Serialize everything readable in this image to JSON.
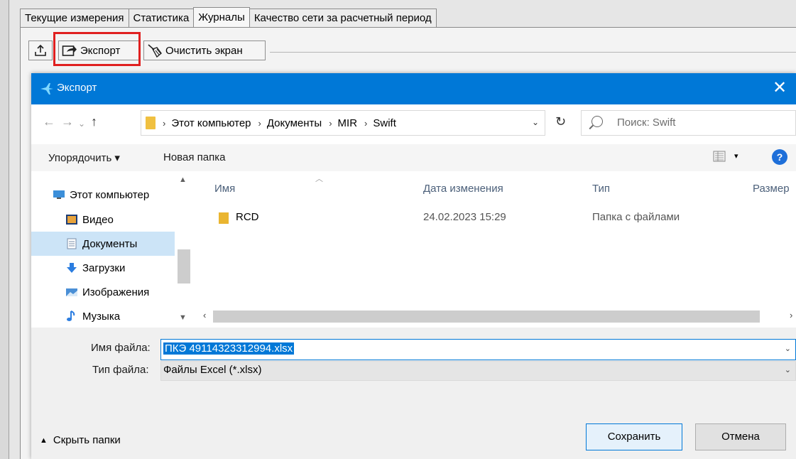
{
  "app": {
    "tabs": [
      "Текущие измерения",
      "Статистика",
      "Журналы",
      "Качество сети за расчетный период"
    ],
    "active_tab_index": 2,
    "toolbar": {
      "export_label": "Экспорт",
      "clear_label": "Очистить экран"
    }
  },
  "dialog": {
    "title": "Экспорт",
    "close_glyph": "✕",
    "nav": {
      "back": "←",
      "forward": "→",
      "recent": "⌄",
      "up": "↑"
    },
    "breadcrumb": [
      "Этот компьютер",
      "Документы",
      "MIR",
      "Swift"
    ],
    "breadcrumb_sep": "›",
    "address_dropdown": "⌄",
    "refresh": "↻",
    "search_placeholder": "Поиск: Swift",
    "commands": {
      "organize": "Упорядочить ▾",
      "new_folder": "Новая папка",
      "view_drop": "▾",
      "help": "?"
    },
    "nav_pane": [
      {
        "label": "Этот компьютер",
        "icon": "computer-icon"
      },
      {
        "label": "Видео",
        "icon": "video-icon"
      },
      {
        "label": "Документы",
        "icon": "documents-icon",
        "selected": true
      },
      {
        "label": "Загрузки",
        "icon": "downloads-icon"
      },
      {
        "label": "Изображения",
        "icon": "pictures-icon"
      },
      {
        "label": "Музыка",
        "icon": "music-icon"
      }
    ],
    "columns": [
      "Имя",
      "Дата изменения",
      "Тип",
      "Размер"
    ],
    "rows": [
      {
        "name": "RCD",
        "date": "24.02.2023 15:29",
        "type": "Папка с файлами"
      }
    ],
    "file_name_label": "Имя файла:",
    "file_name_value": "ПКЭ 49114323312994.xlsx",
    "file_type_label": "Тип файла:",
    "file_type_value": "Файлы Excel (*.xlsx)",
    "hide_folders": "Скрыть папки",
    "save": "Сохранить",
    "cancel": "Отмена"
  },
  "colors": {
    "accent": "#0078d7",
    "highlight": "#e02020"
  }
}
